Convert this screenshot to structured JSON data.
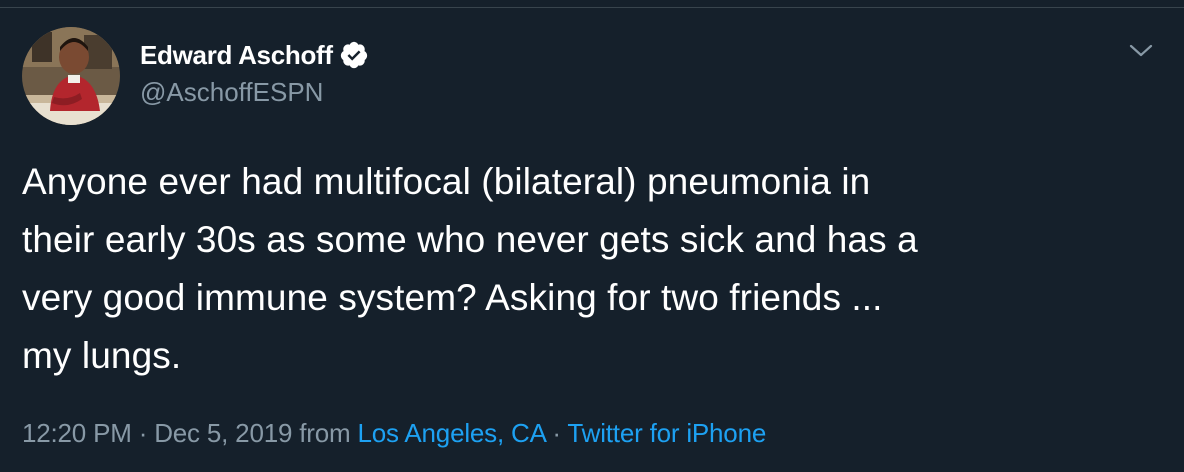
{
  "author": {
    "display_name": "Edward Aschoff",
    "handle": "@AschoffESPN",
    "verified": true
  },
  "tweet": {
    "lines": [
      "Anyone ever had multifocal (bilateral) pneumonia in",
      "their early 30s as some who never gets sick and has a",
      "very good immune system? Asking for two friends ...",
      "my lungs."
    ]
  },
  "meta": {
    "time": "12:20 PM",
    "sep1": "·",
    "date": "Dec 5, 2019",
    "from_label": "from",
    "location": "Los Angeles, CA",
    "sep2": "·",
    "source": "Twitter for iPhone"
  },
  "icons": {
    "verified": "verified-badge-icon",
    "menu": "chevron-down-icon"
  },
  "colors": {
    "background": "#15202b",
    "text": "#ffffff",
    "secondary": "#8899a6",
    "link": "#1da1f2"
  }
}
